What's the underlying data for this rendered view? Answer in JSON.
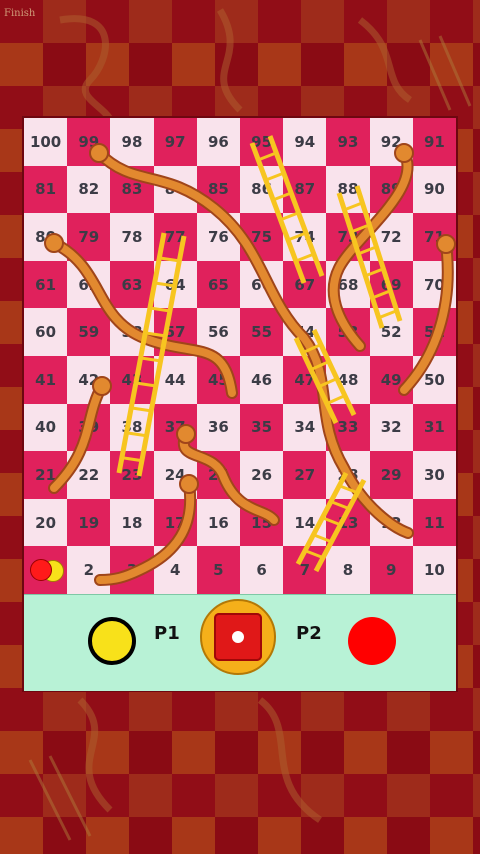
{
  "game": {
    "board": {
      "rows": [
        [
          100,
          99,
          98,
          97,
          96,
          95,
          94,
          93,
          92,
          91
        ],
        [
          81,
          82,
          83,
          84,
          85,
          86,
          87,
          88,
          89,
          90
        ],
        [
          80,
          79,
          78,
          77,
          76,
          75,
          74,
          73,
          72,
          71
        ],
        [
          61,
          62,
          63,
          64,
          65,
          66,
          67,
          68,
          69,
          70
        ],
        [
          60,
          59,
          58,
          57,
          56,
          55,
          54,
          53,
          52,
          51
        ],
        [
          41,
          42,
          43,
          44,
          45,
          46,
          47,
          48,
          49,
          50
        ],
        [
          40,
          39,
          38,
          37,
          36,
          35,
          34,
          33,
          32,
          31
        ],
        [
          21,
          22,
          23,
          24,
          25,
          26,
          27,
          28,
          29,
          30
        ],
        [
          20,
          19,
          18,
          17,
          16,
          15,
          14,
          13,
          12,
          11
        ],
        [
          1,
          2,
          3,
          4,
          5,
          6,
          7,
          8,
          9,
          10
        ]
      ]
    },
    "background_finish_label": "Finish",
    "players": {
      "p1": {
        "label": "P1",
        "color": "#f8e11a"
      },
      "p2": {
        "label": "P2",
        "color": "#ff0000"
      }
    },
    "dice": {
      "value": 1
    },
    "colors": {
      "pink_cell": "#e0215c",
      "white_cell": "#f9e3ec",
      "panel": "#b8f2d6",
      "ladder": "#f7c520",
      "snake": "#e2892f"
    }
  }
}
